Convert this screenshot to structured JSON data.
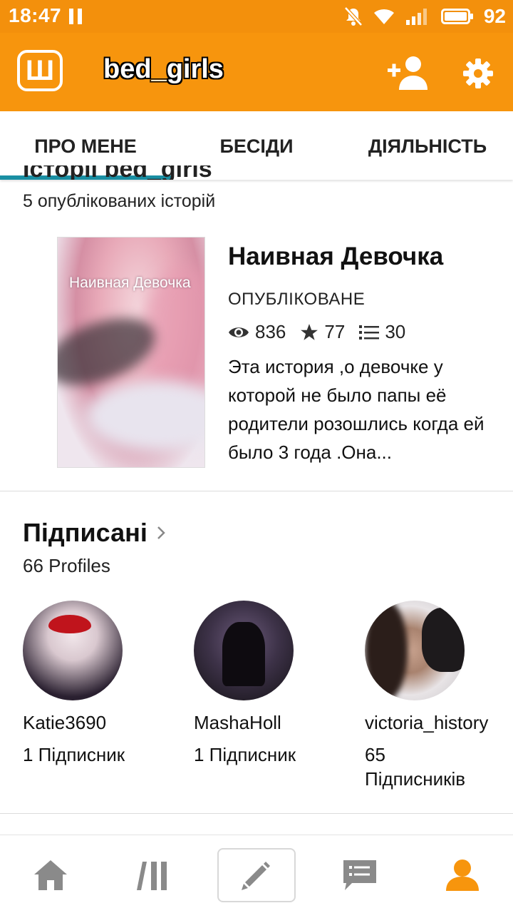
{
  "status_bar": {
    "time": "18:47",
    "battery": "92"
  },
  "app_bar": {
    "logo_letter": "Ш",
    "title": "bed_girls"
  },
  "tabs": [
    {
      "label": "ПРО МЕНЕ",
      "active": true
    },
    {
      "label": "БЕСІДИ",
      "active": false
    },
    {
      "label": "ДІЯЛЬНІСТЬ",
      "active": false
    }
  ],
  "stories_section": {
    "heading_clipped": "Історії bed_girls",
    "count_text": "5 опублікованих історій",
    "story": {
      "cover_text": "Наивная Девочка",
      "title": "Наивная Девочка",
      "status": "ОПУБЛІКОВАНЕ",
      "views": "836",
      "votes": "77",
      "parts": "30",
      "description": "Эта история ,о девочке у которой не было папы её родители розошлись когда ей было 3 года .Она..."
    }
  },
  "following": {
    "title": "Підписані",
    "count_text": "66 Profiles",
    "profiles": [
      {
        "name": "Katie3690",
        "followers": "1 Підписник"
      },
      {
        "name": "MashaHoll",
        "followers": "1 Підписник"
      },
      {
        "name": "victoria_history",
        "followers": "65 Підписників"
      }
    ]
  },
  "bottom_nav": [
    "home-icon",
    "library-icon",
    "write-icon",
    "messages-icon",
    "profile-icon"
  ],
  "colors": {
    "accent": "#f7950d",
    "tab_indicator": "#1a8fa3",
    "icon_gray": "#8a8a8a"
  }
}
